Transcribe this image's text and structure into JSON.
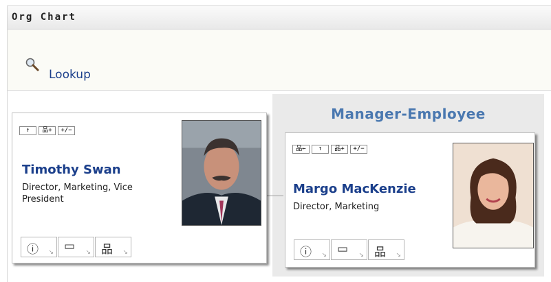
{
  "app": {
    "title": "Org Chart"
  },
  "lookup": {
    "label": "Lookup",
    "icon": "magnifier-icon"
  },
  "manager_panel": {
    "title": "Manager-Employee"
  },
  "cards": [
    {
      "name": "Timothy Swan",
      "role": "Director, Marketing, Vice President",
      "top_buttons": [
        "↑",
        "品+",
        "+/−"
      ],
      "actions": [
        "ⓘ",
        "▭",
        "品"
      ]
    },
    {
      "name": "Margo MacKenzie",
      "role": "Director, Marketing",
      "top_buttons": [
        "品←",
        "↑",
        "品+",
        "+/−"
      ],
      "actions": [
        "ⓘ",
        "▭",
        "品"
      ]
    }
  ],
  "colors": {
    "link": "#1b3f8b",
    "panel_title": "#4a78b0",
    "panel_bg": "#eaeaea"
  }
}
